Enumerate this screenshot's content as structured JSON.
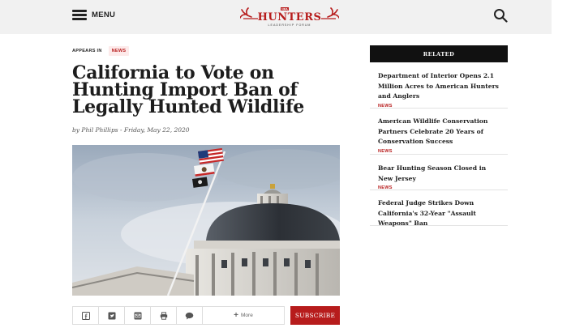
{
  "header": {
    "menu_label": "MENU",
    "logo": {
      "wordmark": "HUNTERS",
      "prefix": "NRA",
      "tagline": "LEADERSHIP FORUM",
      "accent_color": "#b71c1c"
    }
  },
  "article": {
    "appears_in_label": "APPEARS IN",
    "category": "NEWS",
    "title": "California to Vote on Hunting Import Ban of Legally Hunted Wildlife",
    "byline": "by Phil Phillips - Friday, May 22, 2020",
    "hero_image_alt": "State Capitol dome with flags"
  },
  "share_bar": {
    "icons": [
      "facebook-icon",
      "twitter-icon",
      "email-icon",
      "print-icon",
      "comment-icon"
    ],
    "more_label": "More",
    "subscribe_label": "SUBSCRIBE"
  },
  "related": {
    "heading": "RELATED",
    "items": [
      {
        "title": "Department of Interior Opens 2.1 Million Acres to American Hunters and Anglers",
        "tag": "NEWS"
      },
      {
        "title": "American Wildlife Conservation Partners Celebrate 20 Years of Conservation Success",
        "tag": "NEWS"
      },
      {
        "title": "Bear Hunting Season Closed in New Jersey",
        "tag": "NEWS"
      },
      {
        "title": "Federal Judge Strikes Down California's 32-Year \"Assault Weapons\" Ban",
        "tag": ""
      }
    ]
  },
  "colors": {
    "accent": "#b71c1c",
    "header_bg": "#f1f1f1",
    "related_head_bg": "#111111"
  }
}
